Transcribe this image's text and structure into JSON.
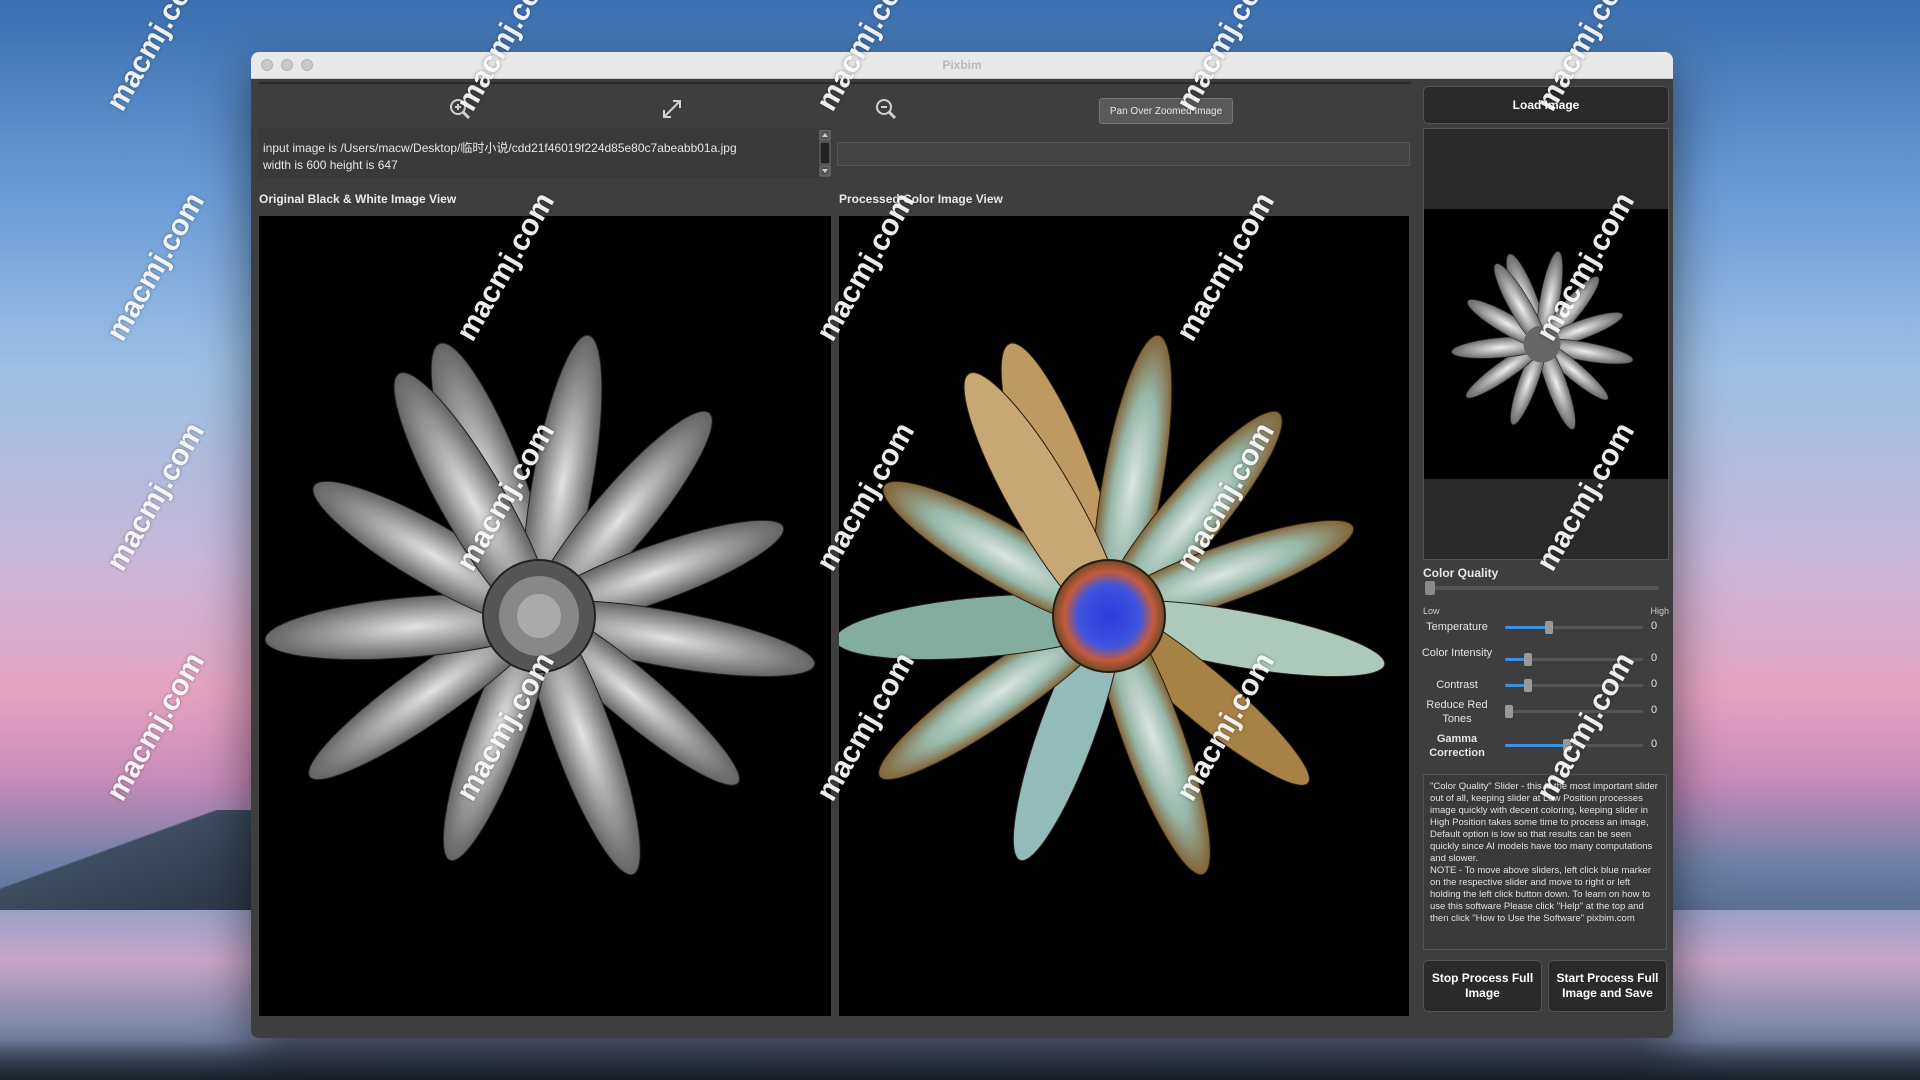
{
  "window": {
    "title": "Pixbim"
  },
  "toolbar": {
    "zoom_in_icon": "zoom-in-icon",
    "fit_icon": "expand-icon",
    "zoom_out_icon": "zoom-out-icon",
    "pan_button": "Pan Over Zoomed Image"
  },
  "info": {
    "line1": "input image is /Users/macw/Desktop/临时小说/cdd21f46019f224d85e80c7abeabb01a.jpg",
    "line2": "width is 600 height is 647"
  },
  "views": {
    "original_label": "Original Black & White  Image View",
    "processed_label": "Processed Color Image View"
  },
  "sidebar": {
    "load_button": "Load Image",
    "color_quality_label": "Color Quality",
    "low_label": "Low",
    "high_label": "High",
    "sliders": [
      {
        "label": "Temperature",
        "value": "0",
        "level": 0.32
      },
      {
        "label": "Color Intensity",
        "value": "0",
        "level": 0.17
      },
      {
        "label": "Contrast",
        "value": "0",
        "level": 0.17
      },
      {
        "label": "Reduce Red Tones",
        "value": "0",
        "level": 0.0
      },
      {
        "label": "Gamma Correction",
        "value": "0",
        "level": 0.45
      }
    ],
    "help_text_1": "\"Color Quality\" Slider - this is the most important slider out of all, keeping slider at Low Position processes image quickly with decent coloring, keeping slider in High Position takes some time to process an image, Default option is low so that results can be seen quickly since AI models have too many computations and slower.",
    "help_text_2": "NOTE - To move above sliders, left click blue marker on the respective slider and move to right or left holding the left click button down. To learn on how to use this software Please click \"Help\" at the top and then click \"How to Use the Software\" pixbim.com",
    "stop_button": "Stop Process Full Image",
    "start_button": "Start Process Full Image and Save"
  },
  "watermark": {
    "text": "macmj.com"
  },
  "colors": {
    "accent": "#3a8fe0",
    "window_bg": "#3e3e3e"
  }
}
